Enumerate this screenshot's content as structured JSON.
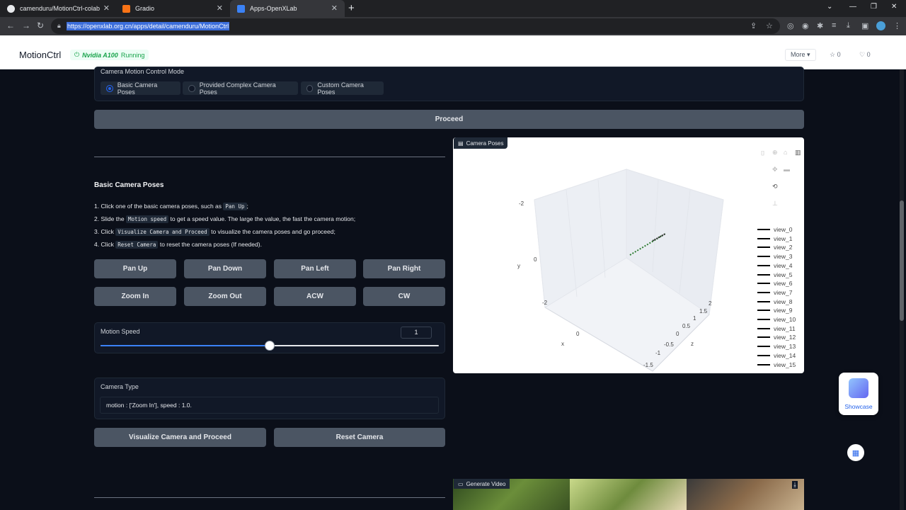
{
  "browser": {
    "tabs": [
      {
        "title": "camenduru/MotionCtrl-colab",
        "icon": "github-icon"
      },
      {
        "title": "Gradio",
        "icon": "gradio-icon"
      },
      {
        "title": "Apps-OpenXLab",
        "icon": "openxlab-icon"
      }
    ],
    "url": "https://openxlab.org.cn/apps/detail/camenduru/MotionCtrl"
  },
  "site_header": {
    "app_name": "MotionCtrl",
    "gpu": "Nvidia A100",
    "status": "Running",
    "more_label": "More",
    "stars": "0",
    "likes": "0"
  },
  "mode": {
    "label": "Camera Motion Control Mode",
    "options": [
      "Basic Camera Poses",
      "Provided Complex Camera Poses",
      "Custom Camera Poses"
    ],
    "selected": "Basic Camera Poses"
  },
  "proceed_label": "Proceed",
  "basic": {
    "title": "Basic Camera Poses",
    "steps": [
      {
        "num": "1.",
        "pre": "Click one of the basic camera poses, such as",
        "code": "Pan Up",
        "post": ";"
      },
      {
        "num": "2.",
        "pre": "Slide the",
        "code": "Motion speed",
        "post": "to get a speed value. The large the value, the fast the camera motion;"
      },
      {
        "num": "3.",
        "pre": "Click",
        "code": "Visualize Camera and Proceed",
        "post": "to visualize the camera poses and go proceed;"
      },
      {
        "num": "4.",
        "pre": "Click",
        "code": "Reset Camera",
        "post": "to reset the camera poses (If needed)."
      }
    ],
    "pose_buttons": [
      "Pan Up",
      "Pan Down",
      "Pan Left",
      "Pan Right",
      "Zoom In",
      "Zoom Out",
      "ACW",
      "CW"
    ]
  },
  "motion_speed": {
    "label": "Motion Speed",
    "value": "1",
    "fraction": 0.5
  },
  "camera_type": {
    "label": "Camera Type",
    "value": "motion : ['Zoom In'], speed : 1.0."
  },
  "actions": {
    "visualize": "Visualize Camera and Proceed",
    "reset": "Reset Camera"
  },
  "plot": {
    "label": "Camera Poses",
    "legend": [
      "view_0",
      "view_1",
      "view_2",
      "view_3",
      "view_4",
      "view_5",
      "view_6",
      "view_7",
      "view_8",
      "view_9",
      "view_10",
      "view_11",
      "view_12",
      "view_13",
      "view_14",
      "view_15"
    ],
    "axis_titles": {
      "x": "x",
      "y": "y",
      "z": "z"
    },
    "ticks": {
      "y": [
        "-2",
        "0",
        "-2"
      ],
      "x": [
        "0"
      ],
      "z": [
        "2",
        "1.5",
        "1",
        "0.5",
        "0",
        "-0.5",
        "-1",
        "-1.5"
      ]
    }
  },
  "video": {
    "label": "Generate Video"
  },
  "showcase_label": "Showcase"
}
